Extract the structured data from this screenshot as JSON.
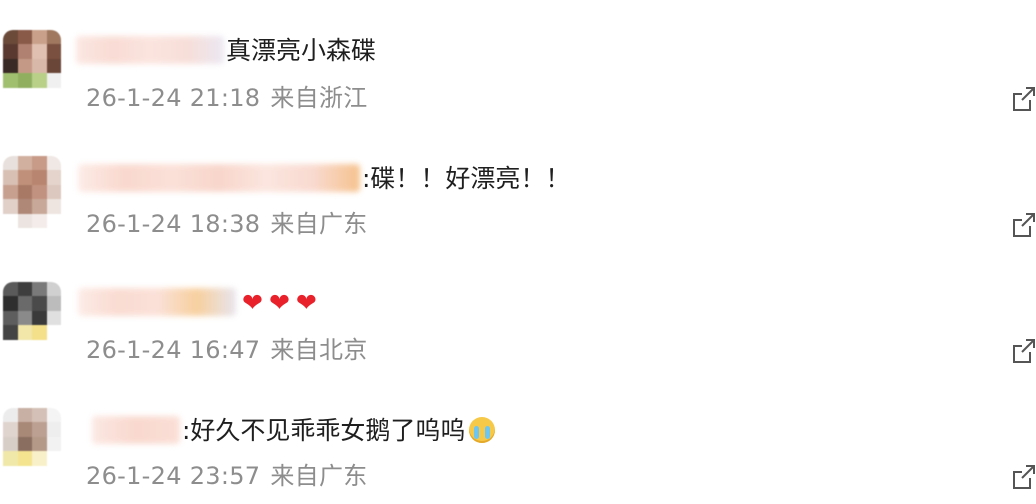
{
  "comments": [
    {
      "text": "真漂亮小森碟",
      "date": "26-1-24 21:18",
      "location": "来自浙江"
    },
    {
      "text": ":碟！！好漂亮！！",
      "date": "26-1-24 18:38",
      "location": "来自广东"
    },
    {
      "text": "",
      "hearts": [
        "❤",
        "❤",
        "❤"
      ],
      "date": "26-1-24 16:47",
      "location": "来自北京"
    },
    {
      "text": ":好久不见乖乖女鹅了呜呜",
      "emoji": "crying-face",
      "date": "26-1-24 23:57",
      "location": "来自广东"
    }
  ],
  "icons": {
    "reply": "reply-edit-icon",
    "heart": "heart-icon"
  },
  "colors": {
    "meta_text": "#8d8d8d",
    "heart": "#e8212b",
    "body_text": "#1f1f1f"
  }
}
